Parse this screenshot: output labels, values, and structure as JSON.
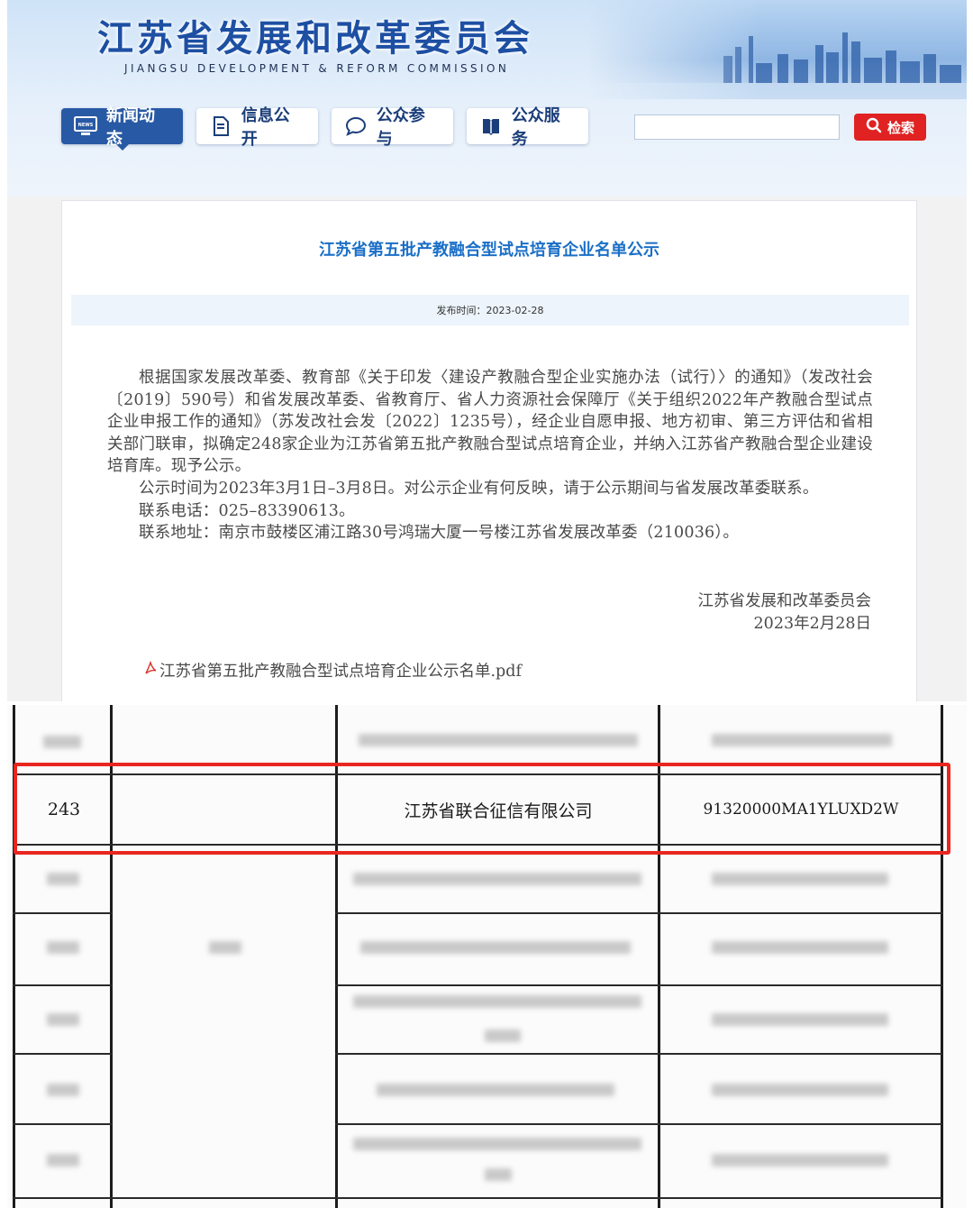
{
  "header": {
    "title": "江苏省发展和改革委员会",
    "subtitle": "JIANGSU DEVELOPMENT & REFORM COMMISSION",
    "nav": [
      {
        "label": "新闻动态",
        "icon": "news-icon",
        "active": true
      },
      {
        "label": "信息公开",
        "icon": "document-icon",
        "active": false
      },
      {
        "label": "公众参与",
        "icon": "chat-icon",
        "active": false
      },
      {
        "label": "公众服务",
        "icon": "book-icon",
        "active": false
      }
    ],
    "search": {
      "placeholder": "",
      "button_label": "检索",
      "button_icon": "search-icon"
    }
  },
  "article": {
    "title": "江苏省第五批产教融合型试点培育企业名单公示",
    "publish_label": "发布时间：2023-02-28",
    "paragraphs": [
      "根据国家发展改革委、教育部《关于印发〈建设产教融合型企业实施办法（试行）〉的通知》（发改社会〔2019〕590号）和省发展改革委、省教育厅、省人力资源社会保障厅《关于组织2022年产教融合型试点企业申报工作的通知》（苏发改社会发〔2022〕1235号），经企业自愿申报、地方初审、第三方评估和省相关部门联审，拟确定248家企业为江苏省第五批产教融合型试点培育企业，并纳入江苏省产教融合型企业建设培育库。现予公示。",
      "公示时间为2023年3月1日–3月8日。对公示企业有何反映，请于公示期间与省发展改革委联系。",
      "联系电话：025–83390613。",
      "联系地址：南京市鼓楼区浦江路30号鸿瑞大厦一号楼江苏省发展改革委（210036）。"
    ],
    "signature_org": "江苏省发展和改革委员会",
    "signature_date": "2023年2月28日",
    "attachment_name": "江苏省第五批产教融合型试点培育企业公示名单.pdf",
    "attachment_icon": "pdf-icon"
  },
  "table": {
    "highlighted_row": {
      "number": "243",
      "region": "",
      "company": "江苏省联合征信有限公司",
      "credit_code": "91320000MA1YLUXD2W"
    },
    "highlight_color": "#e8261f"
  }
}
